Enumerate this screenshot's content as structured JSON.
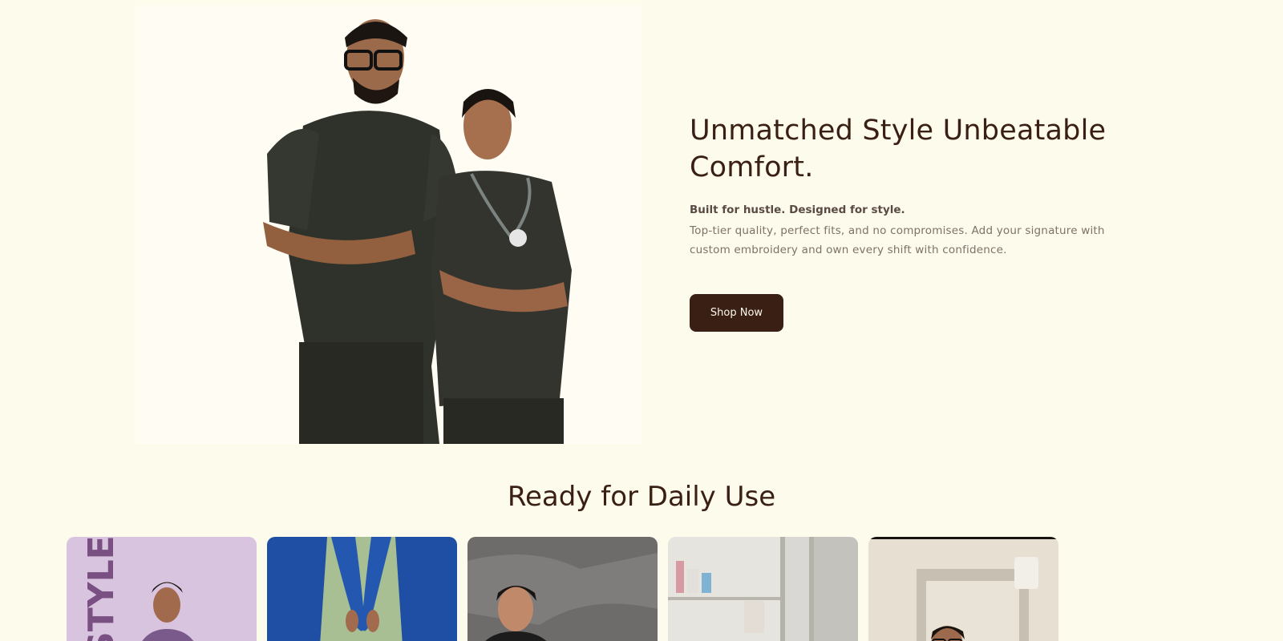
{
  "hero": {
    "title": "Unmatched Style Unbeatable Comfort.",
    "lead": "Built for hustle. Designed for style.",
    "body": "Top-tier quality, perfect fits, and no compromises. Add your signature with custom embroidery and own every shift with confidence.",
    "cta_label": "Shop Now",
    "image_icon": "hero-photo-doctors-in-scrubs"
  },
  "section": {
    "title": "Ready for Daily Use"
  },
  "cards": [
    {
      "name": "video-card-1",
      "overlay_text": "STYLE"
    },
    {
      "name": "video-card-2"
    },
    {
      "name": "video-card-3"
    },
    {
      "name": "video-card-4"
    },
    {
      "name": "video-card-5"
    }
  ],
  "colors": {
    "background": "#fdfbeb",
    "primary": "#3a1f14",
    "muted_text": "#7d716a"
  }
}
